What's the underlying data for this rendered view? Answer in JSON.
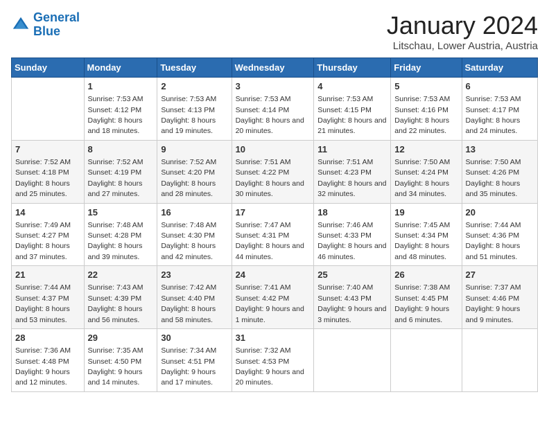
{
  "header": {
    "logo_general": "General",
    "logo_blue": "Blue",
    "title": "January 2024",
    "subtitle": "Litschau, Lower Austria, Austria"
  },
  "days_of_week": [
    "Sunday",
    "Monday",
    "Tuesday",
    "Wednesday",
    "Thursday",
    "Friday",
    "Saturday"
  ],
  "weeks": [
    [
      {
        "day": "",
        "sunrise": "",
        "sunset": "",
        "daylight": ""
      },
      {
        "day": "1",
        "sunrise": "Sunrise: 7:53 AM",
        "sunset": "Sunset: 4:12 PM",
        "daylight": "Daylight: 8 hours and 18 minutes."
      },
      {
        "day": "2",
        "sunrise": "Sunrise: 7:53 AM",
        "sunset": "Sunset: 4:13 PM",
        "daylight": "Daylight: 8 hours and 19 minutes."
      },
      {
        "day": "3",
        "sunrise": "Sunrise: 7:53 AM",
        "sunset": "Sunset: 4:14 PM",
        "daylight": "Daylight: 8 hours and 20 minutes."
      },
      {
        "day": "4",
        "sunrise": "Sunrise: 7:53 AM",
        "sunset": "Sunset: 4:15 PM",
        "daylight": "Daylight: 8 hours and 21 minutes."
      },
      {
        "day": "5",
        "sunrise": "Sunrise: 7:53 AM",
        "sunset": "Sunset: 4:16 PM",
        "daylight": "Daylight: 8 hours and 22 minutes."
      },
      {
        "day": "6",
        "sunrise": "Sunrise: 7:53 AM",
        "sunset": "Sunset: 4:17 PM",
        "daylight": "Daylight: 8 hours and 24 minutes."
      }
    ],
    [
      {
        "day": "7",
        "sunrise": "Sunrise: 7:52 AM",
        "sunset": "Sunset: 4:18 PM",
        "daylight": "Daylight: 8 hours and 25 minutes."
      },
      {
        "day": "8",
        "sunrise": "Sunrise: 7:52 AM",
        "sunset": "Sunset: 4:19 PM",
        "daylight": "Daylight: 8 hours and 27 minutes."
      },
      {
        "day": "9",
        "sunrise": "Sunrise: 7:52 AM",
        "sunset": "Sunset: 4:20 PM",
        "daylight": "Daylight: 8 hours and 28 minutes."
      },
      {
        "day": "10",
        "sunrise": "Sunrise: 7:51 AM",
        "sunset": "Sunset: 4:22 PM",
        "daylight": "Daylight: 8 hours and 30 minutes."
      },
      {
        "day": "11",
        "sunrise": "Sunrise: 7:51 AM",
        "sunset": "Sunset: 4:23 PM",
        "daylight": "Daylight: 8 hours and 32 minutes."
      },
      {
        "day": "12",
        "sunrise": "Sunrise: 7:50 AM",
        "sunset": "Sunset: 4:24 PM",
        "daylight": "Daylight: 8 hours and 34 minutes."
      },
      {
        "day": "13",
        "sunrise": "Sunrise: 7:50 AM",
        "sunset": "Sunset: 4:26 PM",
        "daylight": "Daylight: 8 hours and 35 minutes."
      }
    ],
    [
      {
        "day": "14",
        "sunrise": "Sunrise: 7:49 AM",
        "sunset": "Sunset: 4:27 PM",
        "daylight": "Daylight: 8 hours and 37 minutes."
      },
      {
        "day": "15",
        "sunrise": "Sunrise: 7:48 AM",
        "sunset": "Sunset: 4:28 PM",
        "daylight": "Daylight: 8 hours and 39 minutes."
      },
      {
        "day": "16",
        "sunrise": "Sunrise: 7:48 AM",
        "sunset": "Sunset: 4:30 PM",
        "daylight": "Daylight: 8 hours and 42 minutes."
      },
      {
        "day": "17",
        "sunrise": "Sunrise: 7:47 AM",
        "sunset": "Sunset: 4:31 PM",
        "daylight": "Daylight: 8 hours and 44 minutes."
      },
      {
        "day": "18",
        "sunrise": "Sunrise: 7:46 AM",
        "sunset": "Sunset: 4:33 PM",
        "daylight": "Daylight: 8 hours and 46 minutes."
      },
      {
        "day": "19",
        "sunrise": "Sunrise: 7:45 AM",
        "sunset": "Sunset: 4:34 PM",
        "daylight": "Daylight: 8 hours and 48 minutes."
      },
      {
        "day": "20",
        "sunrise": "Sunrise: 7:44 AM",
        "sunset": "Sunset: 4:36 PM",
        "daylight": "Daylight: 8 hours and 51 minutes."
      }
    ],
    [
      {
        "day": "21",
        "sunrise": "Sunrise: 7:44 AM",
        "sunset": "Sunset: 4:37 PM",
        "daylight": "Daylight: 8 hours and 53 minutes."
      },
      {
        "day": "22",
        "sunrise": "Sunrise: 7:43 AM",
        "sunset": "Sunset: 4:39 PM",
        "daylight": "Daylight: 8 hours and 56 minutes."
      },
      {
        "day": "23",
        "sunrise": "Sunrise: 7:42 AM",
        "sunset": "Sunset: 4:40 PM",
        "daylight": "Daylight: 8 hours and 58 minutes."
      },
      {
        "day": "24",
        "sunrise": "Sunrise: 7:41 AM",
        "sunset": "Sunset: 4:42 PM",
        "daylight": "Daylight: 9 hours and 1 minute."
      },
      {
        "day": "25",
        "sunrise": "Sunrise: 7:40 AM",
        "sunset": "Sunset: 4:43 PM",
        "daylight": "Daylight: 9 hours and 3 minutes."
      },
      {
        "day": "26",
        "sunrise": "Sunrise: 7:38 AM",
        "sunset": "Sunset: 4:45 PM",
        "daylight": "Daylight: 9 hours and 6 minutes."
      },
      {
        "day": "27",
        "sunrise": "Sunrise: 7:37 AM",
        "sunset": "Sunset: 4:46 PM",
        "daylight": "Daylight: 9 hours and 9 minutes."
      }
    ],
    [
      {
        "day": "28",
        "sunrise": "Sunrise: 7:36 AM",
        "sunset": "Sunset: 4:48 PM",
        "daylight": "Daylight: 9 hours and 12 minutes."
      },
      {
        "day": "29",
        "sunrise": "Sunrise: 7:35 AM",
        "sunset": "Sunset: 4:50 PM",
        "daylight": "Daylight: 9 hours and 14 minutes."
      },
      {
        "day": "30",
        "sunrise": "Sunrise: 7:34 AM",
        "sunset": "Sunset: 4:51 PM",
        "daylight": "Daylight: 9 hours and 17 minutes."
      },
      {
        "day": "31",
        "sunrise": "Sunrise: 7:32 AM",
        "sunset": "Sunset: 4:53 PM",
        "daylight": "Daylight: 9 hours and 20 minutes."
      },
      {
        "day": "",
        "sunrise": "",
        "sunset": "",
        "daylight": ""
      },
      {
        "day": "",
        "sunrise": "",
        "sunset": "",
        "daylight": ""
      },
      {
        "day": "",
        "sunrise": "",
        "sunset": "",
        "daylight": ""
      }
    ]
  ]
}
